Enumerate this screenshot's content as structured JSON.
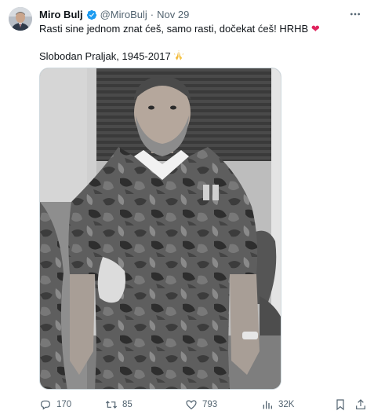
{
  "tweet": {
    "author_name": "Miro Bulj",
    "author_handle": "@MiroBulj",
    "separator": "·",
    "date": "Nov 29",
    "text_line1": "Rasti sine jednom znat ćeš, samo rasti, dočekat ćeš! HRHB",
    "heart_emoji": "❤",
    "text_line2": "Slobodan Praljak, 1945-2017",
    "pray_emoji": "🙏"
  },
  "actions": {
    "replies": "170",
    "retweets": "85",
    "likes": "793",
    "views": "32K"
  },
  "colors": {
    "text_primary": "#0f1419",
    "text_secondary": "#536471",
    "verified_blue": "#1d9bf0",
    "heart_red": "#e0245e",
    "border": "#cfd9de"
  },
  "icons": [
    "avatar",
    "verified-badge-icon",
    "more-icon",
    "reply-icon",
    "retweet-icon",
    "like-icon",
    "views-icon",
    "bookmark-icon",
    "share-icon"
  ]
}
